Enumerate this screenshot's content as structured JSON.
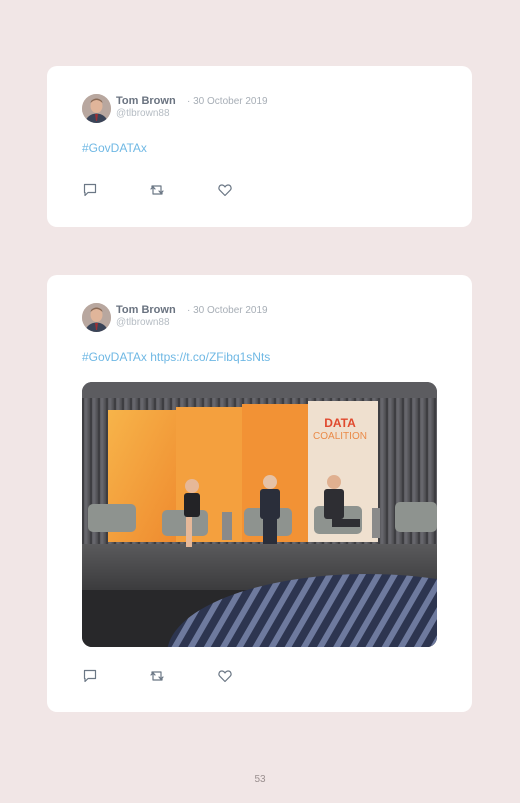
{
  "tweets": [
    {
      "name": "Tom Brown",
      "date": "· 30 October 2019",
      "handle": "@tlbrown88",
      "hashtag": "#GovDATAx",
      "link": ""
    },
    {
      "name": "Tom Brown",
      "date": "· 30 October 2019",
      "handle": "@tlbrown88",
      "hashtag": "#GovDATAx",
      "link": "https://t.co/ZFibq1sNts",
      "photo": {
        "banner_line1": "DATA",
        "banner_line2": "COALITION"
      }
    }
  ],
  "icons": {
    "reply": "reply-icon",
    "retweet": "retweet-icon",
    "like": "heart-icon"
  },
  "colors": {
    "background": "#f1e6e6",
    "card": "#ffffff",
    "link": "#6fb8e4",
    "name": "#6a7380"
  },
  "page_number": "53"
}
